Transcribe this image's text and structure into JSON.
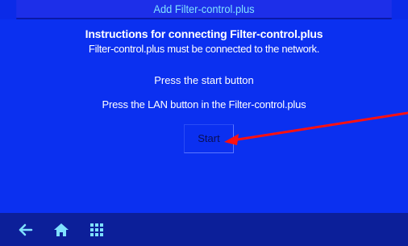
{
  "title_bar": {
    "title": "Add Filter-control.plus"
  },
  "main": {
    "heading": "Instructions for connecting Filter-control.plus",
    "subtitle": "Filter-control.plus must be connected to the network.",
    "instruction_1": "Press the start button",
    "instruction_2": "Press the LAN button in the Filter-control.plus",
    "start_button_label": "Start"
  },
  "bottom_nav": {
    "icons": [
      "back-arrow-icon",
      "home-icon",
      "grid-menu-icon"
    ]
  },
  "colors": {
    "background": "#0b30f0",
    "title_text": "#7fe0ff",
    "bottom_bar": "#0c1f99",
    "icon_color": "#7fe0ff",
    "arrow_color": "#ff1010"
  }
}
